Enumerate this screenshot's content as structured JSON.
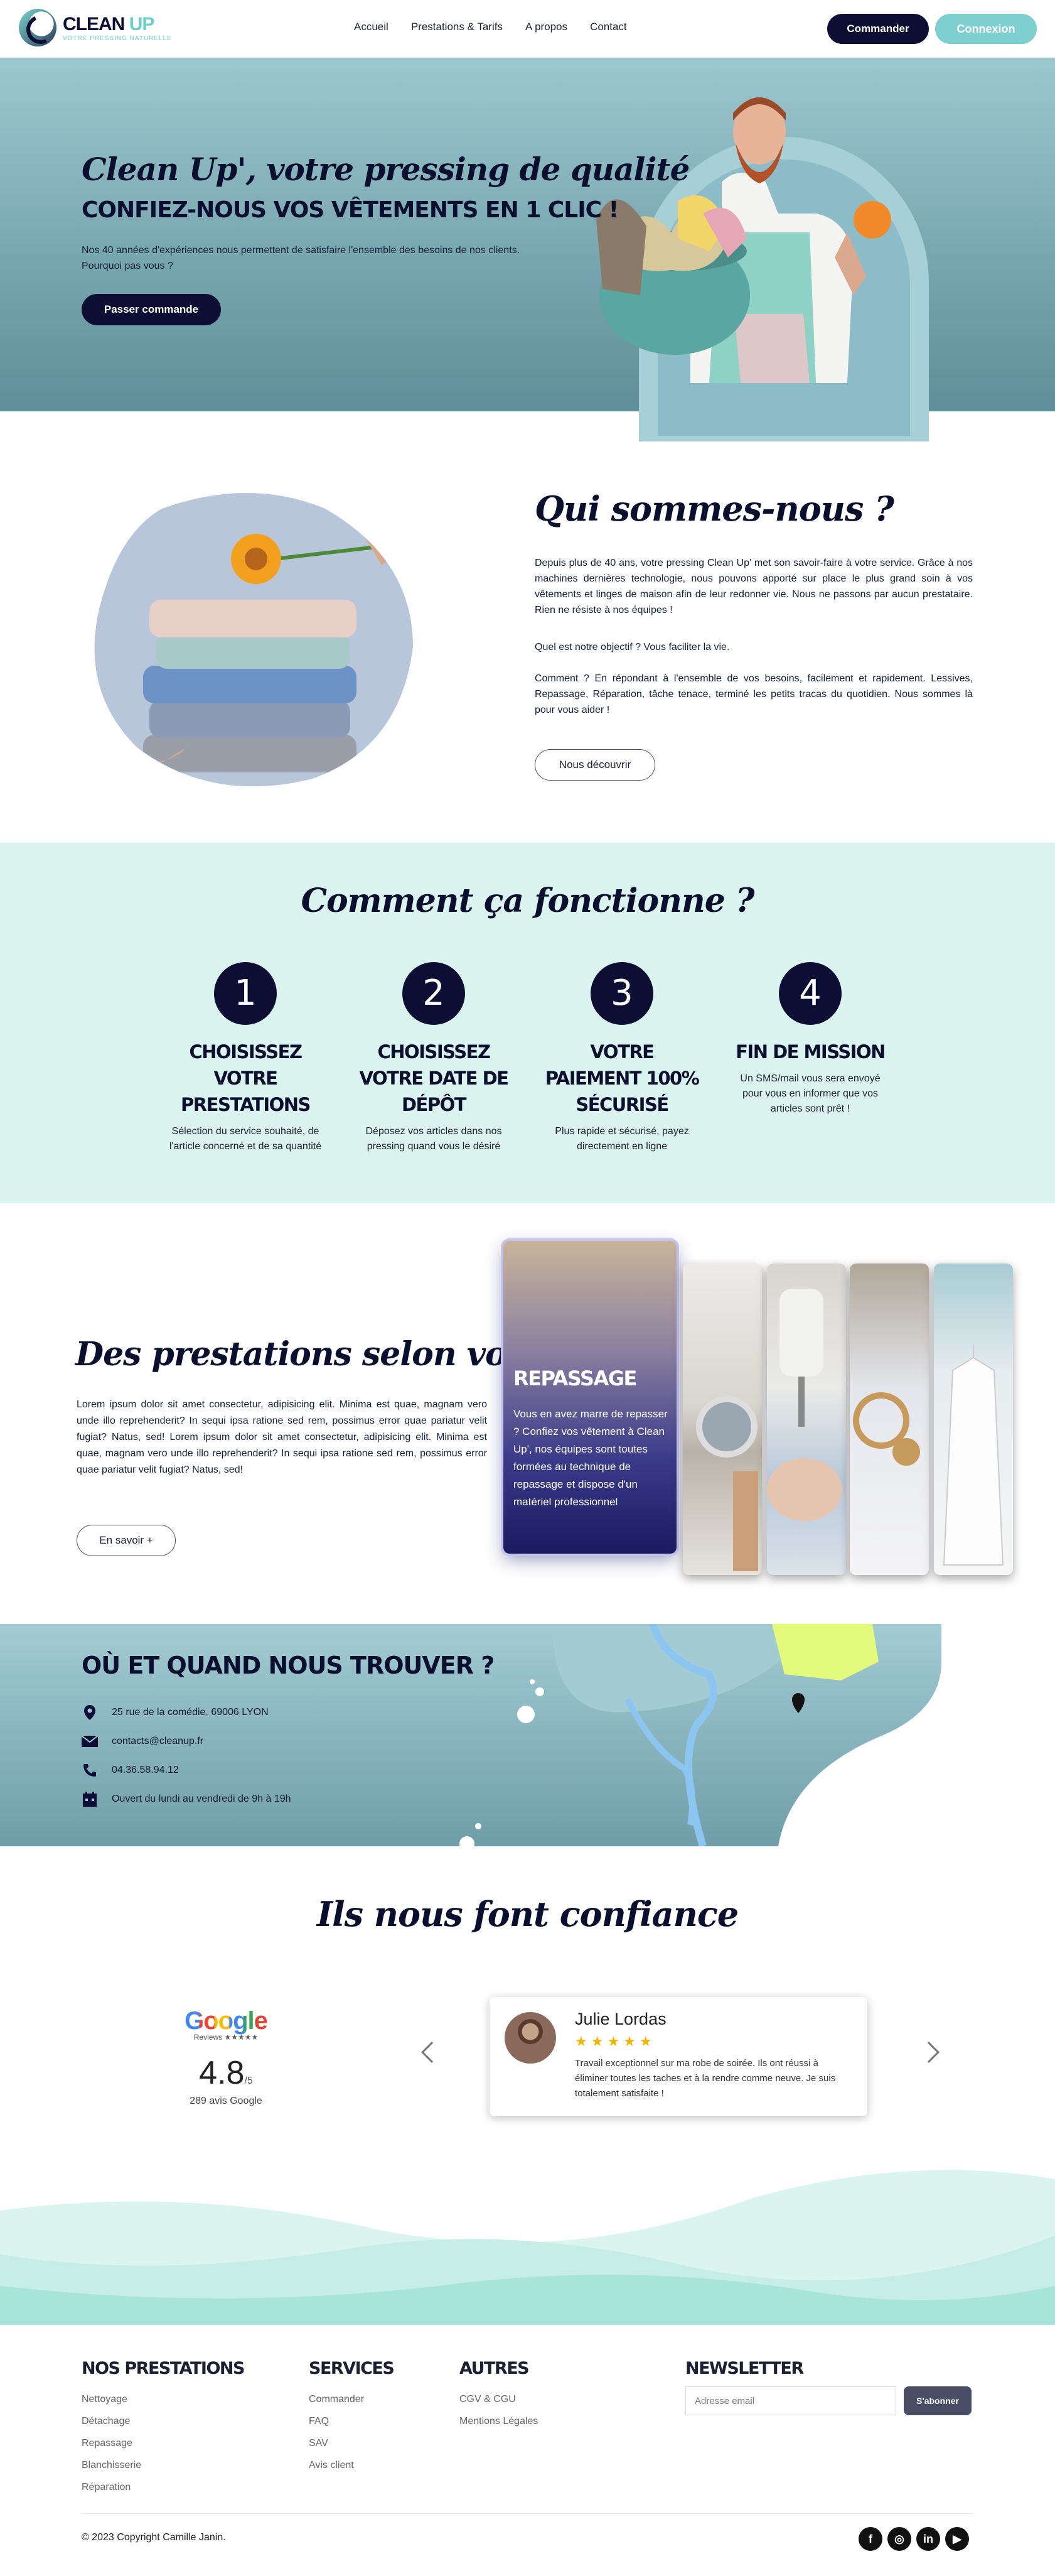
{
  "header": {
    "logo_name_a": "CLEAN",
    "logo_name_b": "UP",
    "logo_tag": "VOTRE PRESSING NATURELLE",
    "nav": [
      "Accueil",
      "Prestations & Tarifs",
      "A propos",
      "Contact"
    ],
    "commander": "Commander",
    "connexion": "Connexion"
  },
  "hero": {
    "title": "Clean Up', votre pressing de qualité",
    "subtitle": "CONFIEZ-NOUS VOS VÊTEMENTS EN 1 CLIC !",
    "text": "Nos 40 années d'expériences nous permettent de satisfaire l'ensemble des besoins de nos clients. Pourquoi pas vous ?",
    "button": "Passer commande"
  },
  "about": {
    "title": "Qui sommes-nous ?",
    "p1": "Depuis plus de 40 ans, votre pressing Clean Up' met son savoir-faire à votre service. Grâce à nos machines dernières technologie, nous pouvons apporté sur place le plus grand soin à vos vêtements et linges de maison afin de leur redonner vie. Nous ne passons par aucun prestataire. Rien ne résiste à nos équipes !",
    "p2": "Quel est notre objectif ? Vous faciliter la vie.",
    "p3": "Comment ? En répondant à l'ensemble de vos besoins, facilement et rapidement. Lessives, Repassage, Réparation, tâche tenace, terminé les petits tracas du quotidien. Nous sommes là pour vous aider !",
    "button": "Nous découvrir"
  },
  "how": {
    "title": "Comment ça fonctionne ?",
    "steps": [
      {
        "num": "1",
        "title": "CHOISISSEZ VOTRE PRESTATIONS",
        "text": "Sélection du service souhaité, de l'article concerné et de sa quantité"
      },
      {
        "num": "2",
        "title": "CHOISISSEZ VOTRE DATE DE DÉPÔT",
        "text": "Déposez vos articles dans nos pressing quand vous le désiré"
      },
      {
        "num": "3",
        "title": "VOTRE PAIEMENT 100% SÉCURISÉ",
        "text": "Plus rapide et sécurisé, payez directement en ligne"
      },
      {
        "num": "4",
        "title": "FIN DE MISSION",
        "text": "Un SMS/mail vous sera envoyé pour vous en informer que vos articles sont prêt !"
      }
    ]
  },
  "services": {
    "title": "Des prestations selon vos besoins",
    "text": "Lorem ipsum dolor sit amet consectetur, adipisicing elit. Minima est quae, magnam vero unde illo reprehenderit? In sequi ipsa ratione sed rem, possimus error quae pariatur velit fugiat? Natus, sed! Lorem ipsum dolor sit amet consectetur, adipisicing elit. Minima est quae, magnam vero unde illo reprehenderit? In sequi ipsa ratione sed rem, possimus error quae pariatur velit fugiat? Natus, sed!",
    "button": "En savoir +",
    "card_title": "REPASSAGE",
    "card_text": "Vous en avez marre de repasser ? Confiez vos vêtement à Clean Up', nos équipes sont toutes formées au technique de repassage et dispose d'un matériel professionnel"
  },
  "location": {
    "title": "OÙ ET QUAND NOUS TROUVER ?",
    "address": "25 rue de la comédie, 69006 LYON",
    "email": "contacts@cleanup.fr",
    "phone": "04.36.58.94.12",
    "hours": "Ouvert du lundi au vendredi de 9h à 19h"
  },
  "reviews": {
    "title": "Ils nous font confiance",
    "google_word": "Google",
    "google_sub": "Reviews ★★★★★",
    "rating": "4.8",
    "rating_max": "/5",
    "count": "289 avis Google",
    "reviewer": "Julie Lordas",
    "stars": "★★★★★",
    "review_text": "Travail exceptionnel sur ma robe de soirée. Ils ont réussi à éliminer toutes les taches et à la rendre comme neuve. Je suis totalement satisfaite !"
  },
  "footer": {
    "col1_title": "NOS PRESTATIONS",
    "col1": [
      "Nettoyage",
      "Détachage",
      "Repassage",
      "Blanchisserie",
      "Réparation"
    ],
    "col2_title": "SERVICES",
    "col2": [
      "Commander",
      "FAQ",
      "SAV",
      "Avis client"
    ],
    "col3_title": "AUTRES",
    "col3": [
      "CGV & CGU",
      "Mentions Légales"
    ],
    "news_title": "NEWSLETTER",
    "news_placeholder": "Adresse email",
    "news_button": "S'abonner",
    "copyright": "© 2023 Copyright Camille Janin.",
    "social": [
      "f",
      "◎",
      "in",
      "▶"
    ]
  },
  "colors": {
    "navy": "#0c0f33",
    "teal": "#7ecfcf",
    "mint": "#dbf4ef"
  }
}
